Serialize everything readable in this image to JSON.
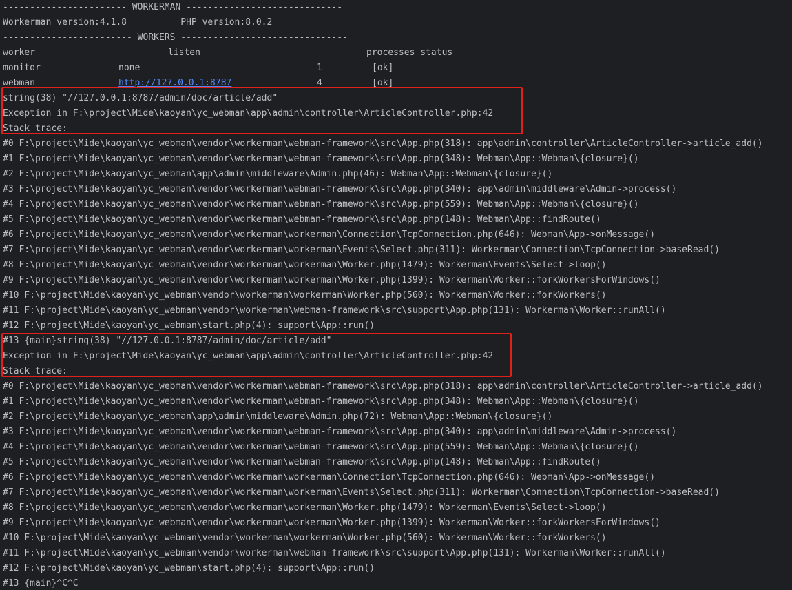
{
  "header": {
    "banner_workerman": "----------------------- WORKERMAN -----------------------------",
    "versions": "Workerman version:4.1.8          PHP version:8.0.2",
    "banner_workers": "------------------------ WORKERS -------------------------------",
    "columns": {
      "worker": "worker",
      "listen": "listen",
      "processes_status": "processes status"
    }
  },
  "workers": [
    {
      "name": "monitor",
      "listen": "none",
      "processes": "1",
      "status": "[ok]",
      "is_link": false
    },
    {
      "name": "webman",
      "listen": "http://127.0.0.1:8787",
      "processes": "4",
      "status": "[ok]",
      "is_link": true
    }
  ],
  "block1": {
    "lines": [
      "string(38) \"//127.0.0.1:8787/admin/doc/article/add\"",
      "Exception in F:\\project\\Mide\\kaoyan\\yc_webman\\app\\admin\\controller\\ArticleController.php:42",
      "Stack trace:"
    ],
    "trace": [
      "#0 F:\\project\\Mide\\kaoyan\\yc_webman\\vendor\\workerman\\webman-framework\\src\\App.php(318): app\\admin\\controller\\ArticleController->article_add()",
      "#1 F:\\project\\Mide\\kaoyan\\yc_webman\\vendor\\workerman\\webman-framework\\src\\App.php(348): Webman\\App::Webman\\{closure}()",
      "#2 F:\\project\\Mide\\kaoyan\\yc_webman\\app\\admin\\middleware\\Admin.php(46): Webman\\App::Webman\\{closure}()",
      "#3 F:\\project\\Mide\\kaoyan\\yc_webman\\vendor\\workerman\\webman-framework\\src\\App.php(340): app\\admin\\middleware\\Admin->process()",
      "#4 F:\\project\\Mide\\kaoyan\\yc_webman\\vendor\\workerman\\webman-framework\\src\\App.php(559): Webman\\App::Webman\\{closure}()",
      "#5 F:\\project\\Mide\\kaoyan\\yc_webman\\vendor\\workerman\\webman-framework\\src\\App.php(148): Webman\\App::findRoute()",
      "#6 F:\\project\\Mide\\kaoyan\\yc_webman\\vendor\\workerman\\workerman\\Connection\\TcpConnection.php(646): Webman\\App->onMessage()",
      "#7 F:\\project\\Mide\\kaoyan\\yc_webman\\vendor\\workerman\\workerman\\Events\\Select.php(311): Workerman\\Connection\\TcpConnection->baseRead()",
      "#8 F:\\project\\Mide\\kaoyan\\yc_webman\\vendor\\workerman\\workerman\\Worker.php(1479): Workerman\\Events\\Select->loop()",
      "#9 F:\\project\\Mide\\kaoyan\\yc_webman\\vendor\\workerman\\workerman\\Worker.php(1399): Workerman\\Worker::forkWorkersForWindows()",
      "#10 F:\\project\\Mide\\kaoyan\\yc_webman\\vendor\\workerman\\workerman\\Worker.php(560): Workerman\\Worker::forkWorkers()",
      "#11 F:\\project\\Mide\\kaoyan\\yc_webman\\vendor\\workerman\\webman-framework\\src\\support\\App.php(131): Workerman\\Worker::runAll()",
      "#12 F:\\project\\Mide\\kaoyan\\yc_webman\\start.php(4): support\\App::run()"
    ]
  },
  "block2": {
    "lines": [
      "#13 {main}string(38) \"//127.0.0.1:8787/admin/doc/article/add\"",
      "Exception in F:\\project\\Mide\\kaoyan\\yc_webman\\app\\admin\\controller\\ArticleController.php:42",
      "Stack trace:"
    ],
    "trace": [
      "#0 F:\\project\\Mide\\kaoyan\\yc_webman\\vendor\\workerman\\webman-framework\\src\\App.php(318): app\\admin\\controller\\ArticleController->article_add()",
      "#1 F:\\project\\Mide\\kaoyan\\yc_webman\\vendor\\workerman\\webman-framework\\src\\App.php(348): Webman\\App::Webman\\{closure}()",
      "#2 F:\\project\\Mide\\kaoyan\\yc_webman\\app\\admin\\middleware\\Admin.php(72): Webman\\App::Webman\\{closure}()",
      "#3 F:\\project\\Mide\\kaoyan\\yc_webman\\vendor\\workerman\\webman-framework\\src\\App.php(340): app\\admin\\middleware\\Admin->process()",
      "#4 F:\\project\\Mide\\kaoyan\\yc_webman\\vendor\\workerman\\webman-framework\\src\\App.php(559): Webman\\App::Webman\\{closure}()",
      "#5 F:\\project\\Mide\\kaoyan\\yc_webman\\vendor\\workerman\\webman-framework\\src\\App.php(148): Webman\\App::findRoute()",
      "#6 F:\\project\\Mide\\kaoyan\\yc_webman\\vendor\\workerman\\workerman\\Connection\\TcpConnection.php(646): Webman\\App->onMessage()",
      "#7 F:\\project\\Mide\\kaoyan\\yc_webman\\vendor\\workerman\\workerman\\Events\\Select.php(311): Workerman\\Connection\\TcpConnection->baseRead()",
      "#8 F:\\project\\Mide\\kaoyan\\yc_webman\\vendor\\workerman\\workerman\\Worker.php(1479): Workerman\\Events\\Select->loop()",
      "#9 F:\\project\\Mide\\kaoyan\\yc_webman\\vendor\\workerman\\workerman\\Worker.php(1399): Workerman\\Worker::forkWorkersForWindows()",
      "#10 F:\\project\\Mide\\kaoyan\\yc_webman\\vendor\\workerman\\workerman\\Worker.php(560): Workerman\\Worker::forkWorkers()",
      "#11 F:\\project\\Mide\\kaoyan\\yc_webman\\vendor\\workerman\\webman-framework\\src\\support\\App.php(131): Workerman\\Worker::runAll()",
      "#12 F:\\project\\Mide\\kaoyan\\yc_webman\\start.php(4): support\\App::run()"
    ]
  },
  "footer": {
    "last_line": "#13 {main}^C^C"
  },
  "colors": {
    "background": "#1e1f22",
    "text": "#bcbec4",
    "link": "#548af7",
    "highlight_box": "#e0201b"
  }
}
